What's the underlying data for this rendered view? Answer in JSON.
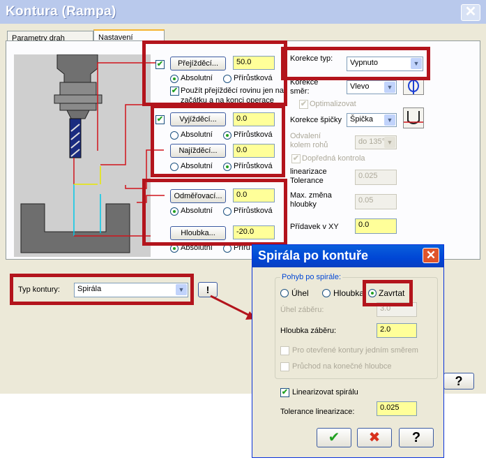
{
  "main": {
    "title": "Kontura (Rampa)",
    "tabs": [
      {
        "label": "Parametry drah nástrojů"
      },
      {
        "label": "Nastavení kontury"
      }
    ],
    "prejizdeci": {
      "button": "Přejížděcí...",
      "value": "50.0",
      "abs": "Absolutní",
      "inc": "Přírůstková",
      "checkbox_label": "Použít přejížděcí rovinu jen na začátku a na konci operace"
    },
    "vyjizdeci": {
      "button": "Vyjížděcí...",
      "value": "0.0",
      "abs": "Absolutní",
      "inc": "Přírůstková"
    },
    "najizdeci": {
      "button": "Najížděcí...",
      "value": "0.0",
      "abs": "Absolutní",
      "inc": "Přírůstková"
    },
    "odmerovaci": {
      "button": "Odměřovací...",
      "value": "0.0",
      "abs": "Absolutní",
      "inc": "Přírůstková"
    },
    "hloubka": {
      "button": "Hloubka...",
      "value": "-20.0",
      "abs": "Absolutní",
      "inc": "Přírů"
    },
    "korekce_typ": {
      "label": "Korekce typ:",
      "value": "Vypnuto"
    },
    "korekce_smer": {
      "label": "Korekce směr:",
      "value": "Vlevo"
    },
    "optimalizovat": "Optimalizovat",
    "korekce_spicky": {
      "label": "Korekce špičky",
      "value": "Špička"
    },
    "odvaleni": {
      "label": "Odvalení kolem rohů",
      "value": "do 135°"
    },
    "doprednа_kontrola": "Dopředná kontrola",
    "linearizace": {
      "label": "linearizace Tolerance",
      "value": "0.025"
    },
    "max_zmena": {
      "label": "Max. změna hloubky",
      "value": "0.05"
    },
    "pridavek": {
      "label": "Přídavek v XY",
      "value": "0.0"
    },
    "typ_kontury": {
      "label": "Typ kontury:",
      "value": "Spirála"
    },
    "info_button": "!"
  },
  "popup": {
    "title": "Spirála po kontuře",
    "group_title": "Pohyb po spirále:",
    "radio_uhel": "Úhel",
    "radio_hloubka": "Hloubka",
    "radio_zavrtat": "Zavrtat",
    "uhel_zaberu": {
      "label": "Úhel záběru:",
      "value": "3.0"
    },
    "hloubka_zaberu": {
      "label": "Hloubka záběru:",
      "value": "2.0"
    },
    "otevrene": "Pro otevřené kontury jedním směrem",
    "pruchod": "Průchod na konečné hloubce",
    "linearizovat": "Linearizovat spirálu",
    "tolerance": {
      "label": "Tolerance linearizace:",
      "value": "0.025"
    },
    "ok": "✔",
    "cancel": "✖",
    "help": "?"
  },
  "colors": {
    "highlight_red": "#b3141c",
    "input_yellow": "#ffff99",
    "titlebar_blue": "#0046d5"
  }
}
